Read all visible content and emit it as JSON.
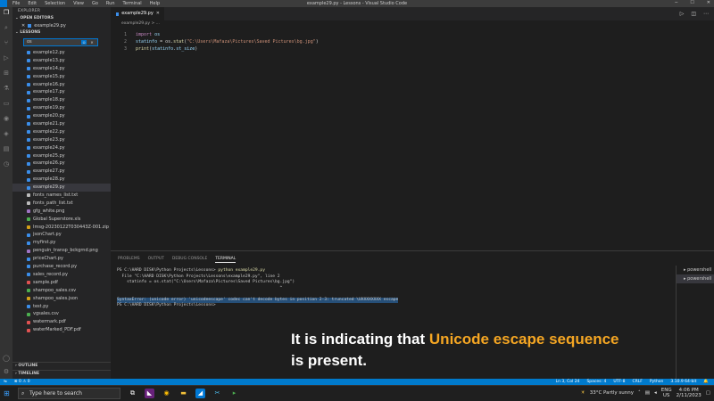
{
  "window": {
    "title": "example29.py - Lessons - Visual Studio Code",
    "menu": [
      "File",
      "Edit",
      "Selection",
      "View",
      "Go",
      "Run",
      "Terminal",
      "Help"
    ]
  },
  "sidebar": {
    "header": "EXPLORER",
    "open_editors_label": "OPEN EDITORS",
    "open_editors": [
      "example29.py"
    ],
    "folder_label": "LESSONS",
    "find_value": "os",
    "files": [
      {
        "name": "example12.py",
        "color": "#3b8eea"
      },
      {
        "name": "example13.py",
        "color": "#3b8eea"
      },
      {
        "name": "example14.py",
        "color": "#3b8eea"
      },
      {
        "name": "example15.py",
        "color": "#3b8eea"
      },
      {
        "name": "example16.py",
        "color": "#3b8eea"
      },
      {
        "name": "example17.py",
        "color": "#3b8eea"
      },
      {
        "name": "example18.py",
        "color": "#3b8eea"
      },
      {
        "name": "example19.py",
        "color": "#3b8eea"
      },
      {
        "name": "example20.py",
        "color": "#3b8eea"
      },
      {
        "name": "example21.py",
        "color": "#3b8eea"
      },
      {
        "name": "example22.py",
        "color": "#3b8eea"
      },
      {
        "name": "example23.py",
        "color": "#3b8eea"
      },
      {
        "name": "example24.py",
        "color": "#3b8eea"
      },
      {
        "name": "example25.py",
        "color": "#3b8eea"
      },
      {
        "name": "example26.py",
        "color": "#3b8eea"
      },
      {
        "name": "example27.py",
        "color": "#3b8eea"
      },
      {
        "name": "example28.py",
        "color": "#3b8eea"
      },
      {
        "name": "example29.py",
        "color": "#3b8eea",
        "selected": true
      },
      {
        "name": "fonts_names_list.txt",
        "color": "#bbbbbb"
      },
      {
        "name": "fonts_path_list.txt",
        "color": "#bbbbbb"
      },
      {
        "name": "gfg_white.png",
        "color": "#a074c4"
      },
      {
        "name": "Global Superstore.xls",
        "color": "#4caf50"
      },
      {
        "name": "Imsg-20230122T030443Z-001.zip",
        "color": "#d4a017"
      },
      {
        "name": "jsonChart.py",
        "color": "#3b8eea"
      },
      {
        "name": "myfirst.py",
        "color": "#3b8eea"
      },
      {
        "name": "penguin_transp_bckgrnd.png",
        "color": "#a074c4"
      },
      {
        "name": "priceChart.py",
        "color": "#3b8eea"
      },
      {
        "name": "purchase_record.py",
        "color": "#3b8eea"
      },
      {
        "name": "sales_record.py",
        "color": "#3b8eea"
      },
      {
        "name": "sample.pdf",
        "color": "#e05252"
      },
      {
        "name": "shampoo_sales.csv",
        "color": "#4caf50"
      },
      {
        "name": "shampoo_sales.json",
        "color": "#d4a017"
      },
      {
        "name": "test.py",
        "color": "#3b8eea"
      },
      {
        "name": "vgsales.csv",
        "color": "#4caf50"
      },
      {
        "name": "watermark.pdf",
        "color": "#e05252"
      },
      {
        "name": "waterMarked_PDF.pdf",
        "color": "#e05252"
      }
    ],
    "outline_label": "OUTLINE",
    "timeline_label": "TIMELINE"
  },
  "editor": {
    "tab_label": "example29.py",
    "breadcrumb": "example29.py > ...",
    "lines": [
      {
        "n": "1",
        "parts": [
          {
            "c": "kw",
            "t": "import "
          },
          {
            "c": "var",
            "t": "os"
          }
        ]
      },
      {
        "n": "2",
        "parts": [
          {
            "c": "var",
            "t": "statinfo"
          },
          {
            "c": "plain",
            "t": " = os."
          },
          {
            "c": "fn",
            "t": "stat"
          },
          {
            "c": "plain",
            "t": "("
          },
          {
            "c": "str",
            "t": "\"C:\\Users\\Mafaza\\Pictures\\Saved Pictures\\bg.jpg\""
          },
          {
            "c": "plain",
            "t": ")"
          }
        ]
      },
      {
        "n": "3",
        "parts": [
          {
            "c": "fn",
            "t": "print"
          },
          {
            "c": "plain",
            "t": "("
          },
          {
            "c": "var",
            "t": "statinfo"
          },
          {
            "c": "plain",
            "t": "."
          },
          {
            "c": "var",
            "t": "st_size"
          },
          {
            "c": "plain",
            "t": ")"
          }
        ]
      }
    ]
  },
  "panel": {
    "tabs": [
      "PROBLEMS",
      "OUTPUT",
      "DEBUG CONSOLE",
      "TERMINAL"
    ],
    "active_tab": "TERMINAL",
    "terminal": [
      {
        "prompt": "PS C:\\HARD DISK\\Python Projects\\Lessons> ",
        "cmd": "python example29.py"
      },
      {
        "text": "  File \"C:\\HARD DISK\\Python Projects\\Lessons\\example29.py\", line 2"
      },
      {
        "text": "    statinfo = os.stat(\"C:\\Users\\Mafaza\\Pictures\\Saved Pictures\\bg.jpg\")"
      },
      {
        "text": "                                                                  ^"
      },
      {
        "text": ""
      },
      {
        "text": "SyntaxError: (unicode error) 'unicodeescape' codec can't decode bytes in position 2-3: truncated \\UXXXXXXXX escape",
        "error": true
      },
      {
        "text": "PS C:\\HARD DISK\\Python Projects\\Lessons> "
      }
    ],
    "shells": [
      "powershell",
      "powershell"
    ]
  },
  "caption": {
    "line1_pre": "It is indicating that ",
    "line1_hl": "Unicode escape sequence",
    "line2": "is present."
  },
  "status": {
    "right": [
      "Ln 3, Col 24",
      "Spaces: 4",
      "UTF-8",
      "CRLF",
      "Python",
      "3.10.9 64-bit"
    ]
  },
  "taskbar": {
    "search_placeholder": "Type here to search",
    "weather": "33°C  Partly sunny",
    "lang": "ENG",
    "region": "US",
    "time": "4:06 PM",
    "date": "2/11/2023"
  }
}
